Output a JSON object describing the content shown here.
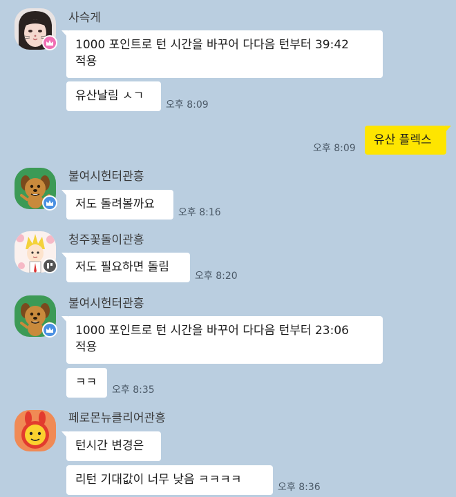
{
  "messages": [
    {
      "sender": "사슥게",
      "badge": "crown-icon",
      "avatar": "cat-face-avatar",
      "lines": [
        {
          "text": "1000 포인트로 턴 시간을 바꾸어 다다음 턴부터 39:42\n적용",
          "time": ""
        },
        {
          "text": "유산날림 ㅅㄱ",
          "time": "오후 8:09"
        }
      ]
    },
    {
      "mine": true,
      "lines": [
        {
          "text": "유산 플렉스",
          "time": "오후 8:09"
        }
      ]
    },
    {
      "sender": "불여시헌터관흥",
      "badge": "crown-icon",
      "avatar": "dog-character-avatar",
      "lines": [
        {
          "text": "저도 돌려볼까요",
          "time": "오후 8:16"
        }
      ]
    },
    {
      "sender": "청주꽃돌이관흥",
      "badge": "manager-icon",
      "avatar": "cartoon-boy-avatar",
      "lines": [
        {
          "text": "저도 필요하면 돌림",
          "time": "오후 8:20"
        }
      ]
    },
    {
      "sender": "불여시헌터관흥",
      "badge": "crown-icon",
      "avatar": "dog-character-avatar",
      "lines": [
        {
          "text": "1000 포인트로 턴 시간을 바꾸어 다다음 턴부터 23:06\n적용",
          "time": ""
        },
        {
          "text": "ㅋㅋ",
          "time": "오후 8:35"
        }
      ]
    },
    {
      "sender": "페로몬뉴클리어관흥",
      "avatar": "yellow-character-avatar",
      "lines": [
        {
          "text": "턴시간 변경은",
          "time": ""
        },
        {
          "text": "리턴 기대값이 너무 낮음 ㅋㅋㅋㅋ",
          "time": "오후 8:36"
        }
      ]
    }
  ],
  "colors": {
    "background": "#bacee0",
    "bubble_other": "#ffffff",
    "bubble_mine": "#fee500",
    "crown_pink": "#f06fb4",
    "crown_blue": "#4a90e2",
    "manager_badge": "#555555"
  }
}
